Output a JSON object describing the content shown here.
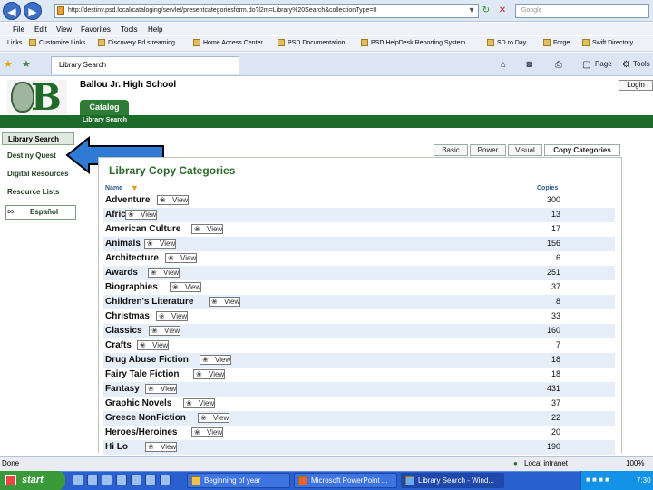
{
  "browser": {
    "address_url": "http://destiny.psd.local/cataloging/servlet/presentcategoriesform.do?l2m=Library%20Search&collectionType=0",
    "search_placeholder": "Google",
    "menu": [
      "File",
      "Edit",
      "View",
      "Favorites",
      "Tools",
      "Help"
    ],
    "links_label": "Links",
    "links": [
      "Customize Links",
      "Discovery Ed streaming",
      "Home Access Center",
      "PSD Documentation",
      "PSD HelpDesk Reporting System",
      "SD  ro Day",
      "Forge",
      "Swift Directory"
    ],
    "tab_title": "Library Search",
    "toolbar_right": [
      "Page",
      "Tools"
    ]
  },
  "site": {
    "school_name": "Ballou Jr. High School",
    "login_label": "Login",
    "catalog_tab": "Catalog",
    "sub_nav": "Library Search"
  },
  "sidebar": {
    "items": [
      "Library Search",
      "Destiny Quest",
      "Digital Resources",
      "Resource Lists"
    ],
    "espanol": "Español"
  },
  "search_tabs": [
    "Basic",
    "Power",
    "Visual",
    "Copy Categories"
  ],
  "panel": {
    "legend": "Library Copy Categories",
    "col_name": "Name",
    "col_copies": "Copies",
    "view_label": "View",
    "rows": [
      {
        "name": "Adventure",
        "count": "300"
      },
      {
        "name": "Africa",
        "count": "13"
      },
      {
        "name": "American Culture",
        "count": "17"
      },
      {
        "name": "Animals",
        "count": "156"
      },
      {
        "name": "Architecture",
        "count": "6"
      },
      {
        "name": "Awards",
        "count": "251"
      },
      {
        "name": "Biographies",
        "count": "37"
      },
      {
        "name": "Children's Literature",
        "count": "8"
      },
      {
        "name": "Christmas",
        "count": "33"
      },
      {
        "name": "Classics",
        "count": "160"
      },
      {
        "name": "Crafts",
        "count": "7"
      },
      {
        "name": "Drug Abuse Fiction",
        "count": "18"
      },
      {
        "name": "Fairy Tale Fiction",
        "count": "18"
      },
      {
        "name": "Fantasy",
        "count": "431"
      },
      {
        "name": "Graphic Novels",
        "count": "37"
      },
      {
        "name": "Greece NonFiction",
        "count": "22"
      },
      {
        "name": "Heroes/Heroines",
        "count": "20"
      },
      {
        "name": "Hi Lo",
        "count": "190"
      }
    ]
  },
  "status": {
    "left": "Done",
    "zone": "Local intranet",
    "zoom": "100%"
  },
  "taskbar": {
    "start": "start",
    "tasks": [
      "Beginning of year",
      "Microsoft PowerPoint ...",
      "Library Search - Wind..."
    ],
    "clock": "7:30"
  },
  "colors": {
    "school_green": "#1d6b28",
    "arrow_blue": "#2e7bd6",
    "row_stripe": "#e6eef9"
  }
}
